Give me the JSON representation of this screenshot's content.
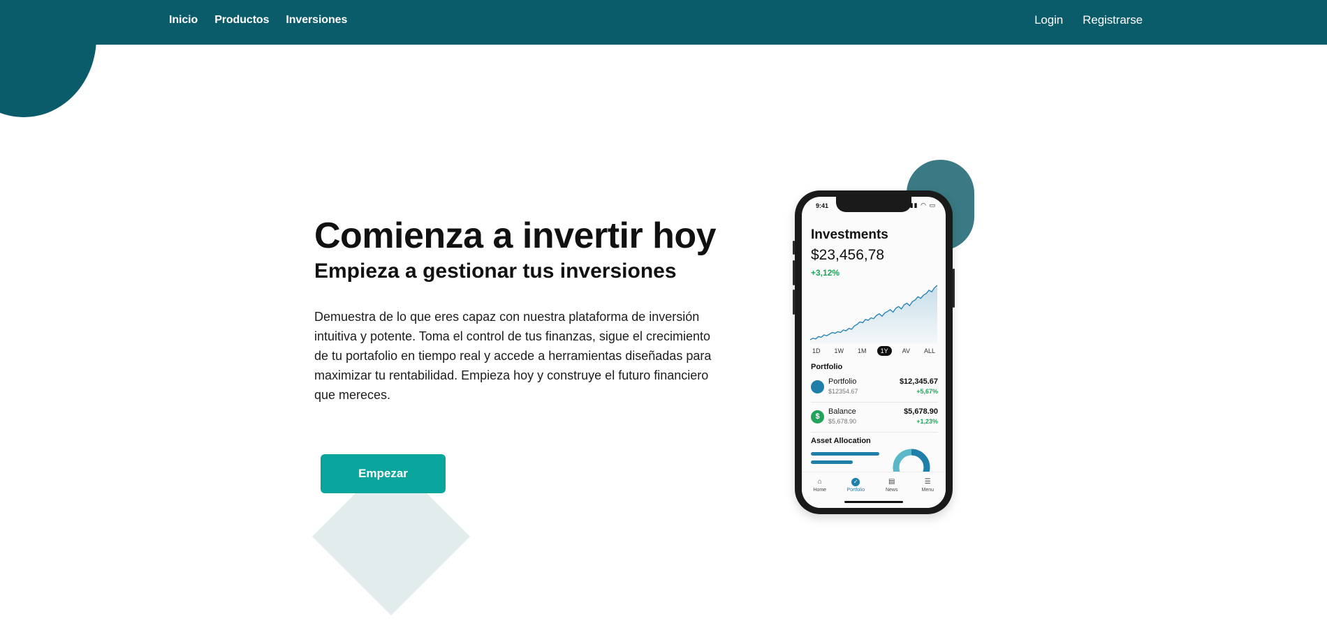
{
  "nav": {
    "links": [
      "Inicio",
      "Productos",
      "Inversiones"
    ],
    "login": "Login",
    "register": "Registrarse"
  },
  "hero": {
    "title": "Comienza a invertir hoy",
    "subtitle": "Empieza a gestionar tus inversiones",
    "body": "Demuestra de lo que eres capaz con nuestra plataforma de inversión intuitiva y potente. Toma el control de tus finanzas, sigue el crecimiento de tu portafolio en tiempo real y accede a herramientas diseñadas para maximizar tu rentabilidad. Empieza hoy y construye el futuro financiero que mereces.",
    "cta": "Empezar"
  },
  "phone": {
    "status_time": "9:41",
    "title": "Investments",
    "total": "$23,456,78",
    "change": "+3,12%",
    "ranges": [
      "1D",
      "1W",
      "1M",
      "1Y",
      "AV",
      "ALL"
    ],
    "active_range": "1Y",
    "portfolio_label": "Portfolio",
    "rows": [
      {
        "icon": "",
        "name": "Portfolio",
        "sub": "$12354.67",
        "amount": "$12,345.67",
        "change": "+5,67%"
      },
      {
        "icon": "$",
        "name": "Balance",
        "sub": "$5,678.90",
        "amount": "$5,678.90",
        "change": "+1,23%"
      }
    ],
    "allocation_label": "Asset Allocation",
    "tabs": [
      "Home",
      "Portfolio",
      "News",
      "Menu"
    ],
    "active_tab": "Portfolio",
    "sparkline": [
      3,
      5,
      4,
      7,
      6,
      9,
      8,
      10,
      12,
      11,
      13,
      12,
      15,
      14,
      17,
      16,
      20,
      22,
      25,
      24,
      28,
      27,
      30,
      29,
      33,
      35,
      32,
      36,
      38,
      40,
      37,
      42,
      44,
      41,
      46,
      48,
      45,
      50,
      52,
      56,
      54,
      58,
      60,
      64,
      62,
      67,
      70
    ],
    "sparkline_color": "#2a86b5",
    "colors": {
      "portfolio_icon": "#1f7fa8",
      "balance_icon": "#21a35a",
      "change_positive": "#21a35a"
    }
  },
  "colors": {
    "nav_bg": "#0b5c6b",
    "cta": "#0aa69e",
    "diamond": "#e2ecec",
    "pill": "#3a7a84"
  }
}
